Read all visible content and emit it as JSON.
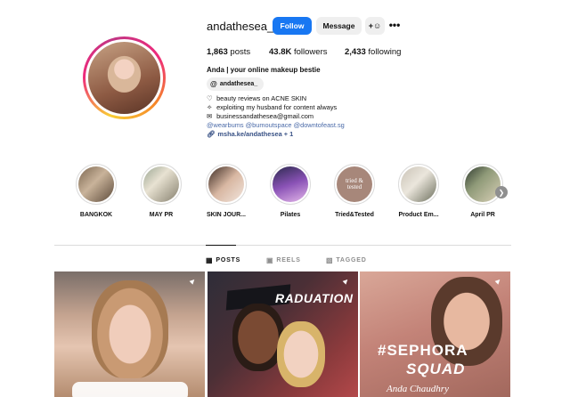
{
  "profile": {
    "username": "andathesea_",
    "follow_label": "Follow",
    "message_label": "Message",
    "add_user_icon": "+R",
    "more_label": "•••"
  },
  "stats": {
    "posts_value": "1,863",
    "posts_label": "posts",
    "followers_value": "43.8K",
    "followers_label": "followers",
    "following_value": "2,433",
    "following_label": "following"
  },
  "bio": {
    "name": "Anda | your online makeup bestie",
    "threads_handle": "andathesea_",
    "line1": "beauty reviews on ACNE SKIN",
    "line1_icon": "♡",
    "line2": "exploiting my husband for content always",
    "line2_icon": "✧",
    "line3": "businessandathesea@gmail.com",
    "line3_icon": "✉",
    "tags": "@wearbums @bumoutspace @downtofeast.sg",
    "link": "msha.ke/andathesea + 1"
  },
  "highlights": [
    {
      "label": "BANGKOK"
    },
    {
      "label": "MAY PR"
    },
    {
      "label": "SKIN JOUR..."
    },
    {
      "label": "Pilates"
    },
    {
      "label": "Tried&Tested",
      "cover_text_1": "tried &",
      "cover_text_2": "tested"
    },
    {
      "label": "Product Em..."
    },
    {
      "label": "April PR"
    }
  ],
  "tabs": {
    "posts": "POSTS",
    "reels": "REELS",
    "tagged": "TAGGED"
  },
  "posts": [
    {
      "pinned": true
    },
    {
      "pinned": true,
      "overlay_text": "RADUATION"
    },
    {
      "pinned": true,
      "overlay_text_1": "#SEPHORA",
      "overlay_text_2": "SQUAD",
      "caption": "Anda Chaudhry"
    }
  ],
  "colors": {
    "follow_button": "#1877f2",
    "secondary_button": "#efefef",
    "link": "#385185",
    "tags": "#4a6aa8"
  }
}
